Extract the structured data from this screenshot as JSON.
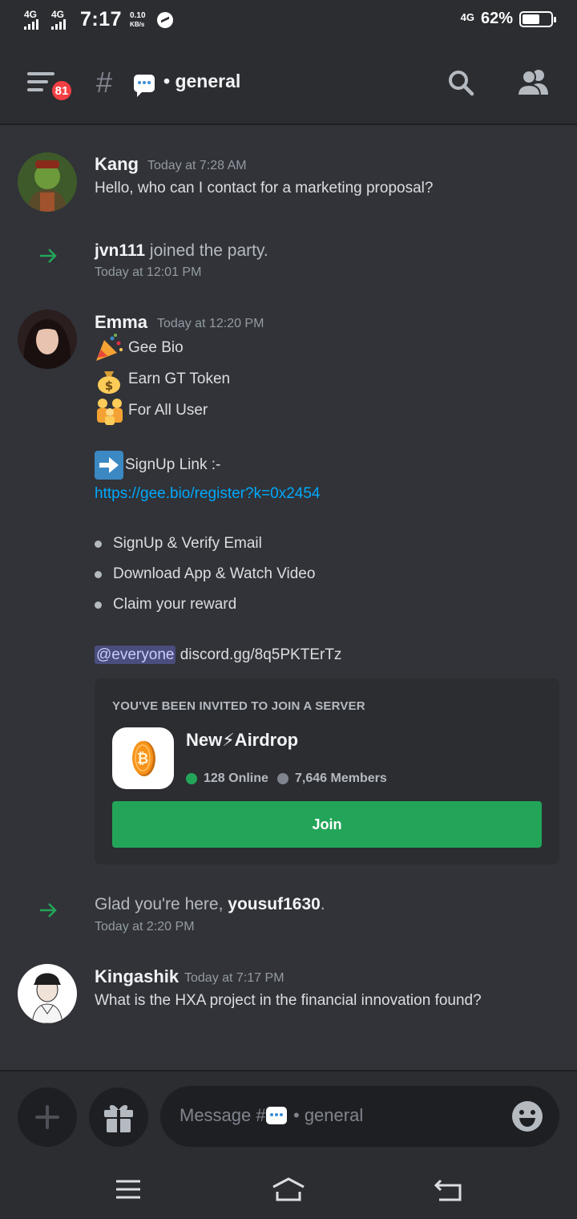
{
  "status_bar": {
    "net1_label": "4G",
    "net2_label": "4G",
    "time": "7:17",
    "speed_value": "0.10",
    "speed_unit": "KB/s",
    "net3_label": "4G",
    "battery_pct": "62%",
    "battery_level": 0.62
  },
  "header": {
    "badge_count": "81",
    "channel_prefix": "#",
    "channel_name": "• general"
  },
  "messages": [
    {
      "author": "Kang",
      "timestamp": "Today at 7:28 AM",
      "text": "Hello, who can I contact for a marketing proposal?"
    },
    {
      "system_user": "jvn111",
      "system_text": " joined the party.",
      "timestamp": "Today at 12:01 PM"
    },
    {
      "author": "Emma",
      "timestamp": "Today at 12:20 PM",
      "lines": [
        "Gee Bio",
        "Earn GT Token",
        "For All User"
      ],
      "signup_label": "SignUp Link :-",
      "link": "https://gee.bio/register?k=0x2454",
      "bullets": [
        "SignUp & Verify Email",
        "Download App & Watch Video",
        "Claim your reward"
      ],
      "mention": "@everyone",
      "invite_code": " discord.gg/8q5PKTErTz",
      "invite": {
        "header": "YOU'VE BEEN INVITED TO JOIN A SERVER",
        "server_name": "New⚡Airdrop",
        "online": "128 Online",
        "members": "7,646 Members",
        "join_label": "Join"
      }
    },
    {
      "system_prefix": "Glad you're here, ",
      "system_user": "yousuf1630",
      "system_suffix": ".",
      "timestamp": "Today at 2:20 PM"
    },
    {
      "author": "Kingashik",
      "timestamp": "Today at 7:17 PM",
      "text": "What is the HXA project in the financial innovation found?"
    }
  ],
  "composer": {
    "placeholder_prefix": "Message #",
    "placeholder_suffix": "• general"
  },
  "colors": {
    "background": "#313338",
    "header": "#2b2d31",
    "accent_green": "#23a559",
    "link": "#00a8fc",
    "badge_red": "#f23f43"
  },
  "icons": [
    "menu-icon",
    "hash-icon",
    "speech-bubble-icon",
    "search-icon",
    "members-icon",
    "arrow-right-icon",
    "party-popper-icon",
    "money-bag-icon",
    "family-icon",
    "right-arrow-button-icon",
    "bitcoin-coin-icon",
    "plus-icon",
    "gift-icon",
    "smile-icon",
    "nav-menu-icon",
    "nav-home-icon",
    "nav-back-icon"
  ]
}
